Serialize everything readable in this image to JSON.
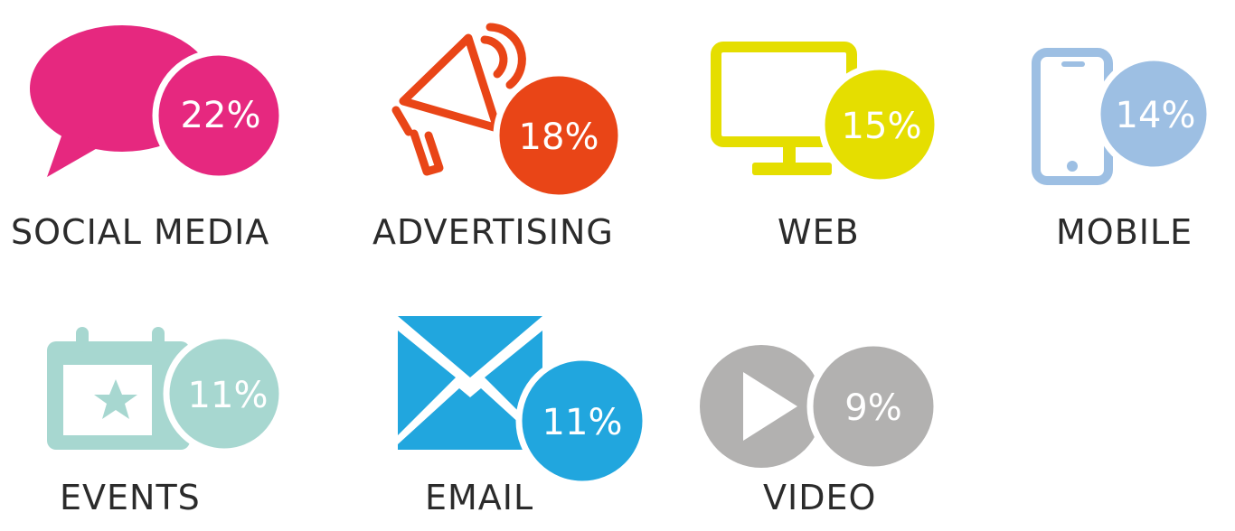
{
  "channels": [
    {
      "name": "SOCIAL MEDIA",
      "percent": "22%",
      "color": "#e6287f",
      "icon": "speech-bubble-icon"
    },
    {
      "name": "ADVERTISING",
      "percent": "18%",
      "color": "#e94517",
      "icon": "megaphone-icon"
    },
    {
      "name": "WEB",
      "percent": "15%",
      "color": "#e5de00",
      "icon": "desktop-monitor-icon"
    },
    {
      "name": "MOBILE",
      "percent": "14%",
      "color": "#9dbfe3",
      "icon": "smartphone-icon"
    },
    {
      "name": "EVENTS",
      "percent": "11%",
      "color": "#a7d7d0",
      "icon": "calendar-star-icon"
    },
    {
      "name": "EMAIL",
      "percent": "11%",
      "color": "#21a6de",
      "icon": "envelope-icon"
    },
    {
      "name": "VIDEO",
      "percent": "9%",
      "color": "#b2b1b0",
      "icon": "play-button-icon"
    }
  ]
}
